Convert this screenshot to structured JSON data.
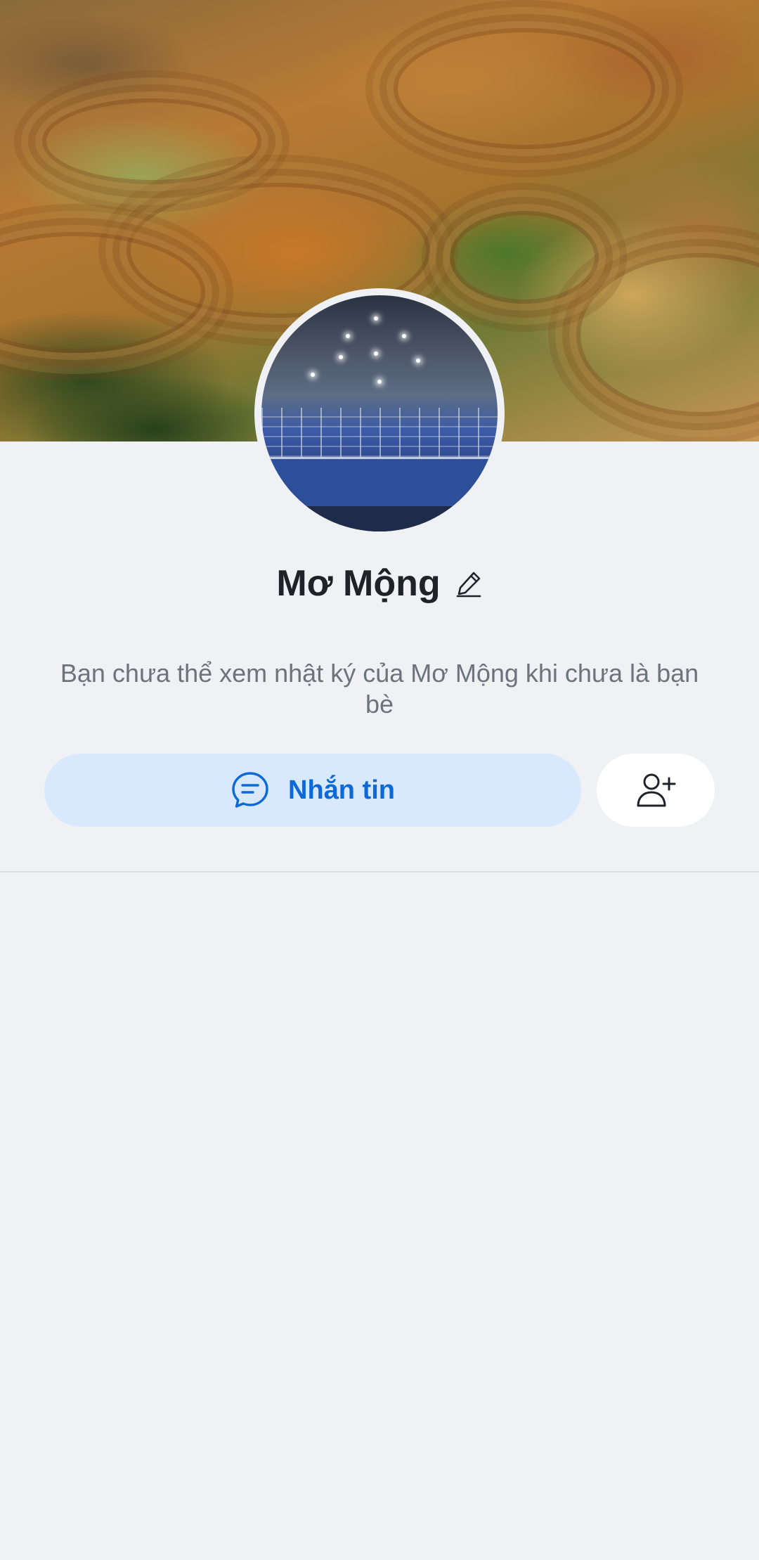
{
  "profile": {
    "name": "Mơ Mộng",
    "notice": "Bạn chưa thể xem nhật ký của Mơ Mộng khi chưa là bạn bè"
  },
  "actions": {
    "message_label": "Nhắn tin"
  },
  "icons": {
    "edit": "pencil-icon",
    "message": "chat-bubble-icon",
    "add_friend": "user-plus-icon"
  },
  "colors": {
    "background": "#f0f1f5",
    "accent": "#0d68d8",
    "message_button_bg": "#d8e9fe",
    "name_text": "#1f2329",
    "notice_text": "#6e737b"
  }
}
